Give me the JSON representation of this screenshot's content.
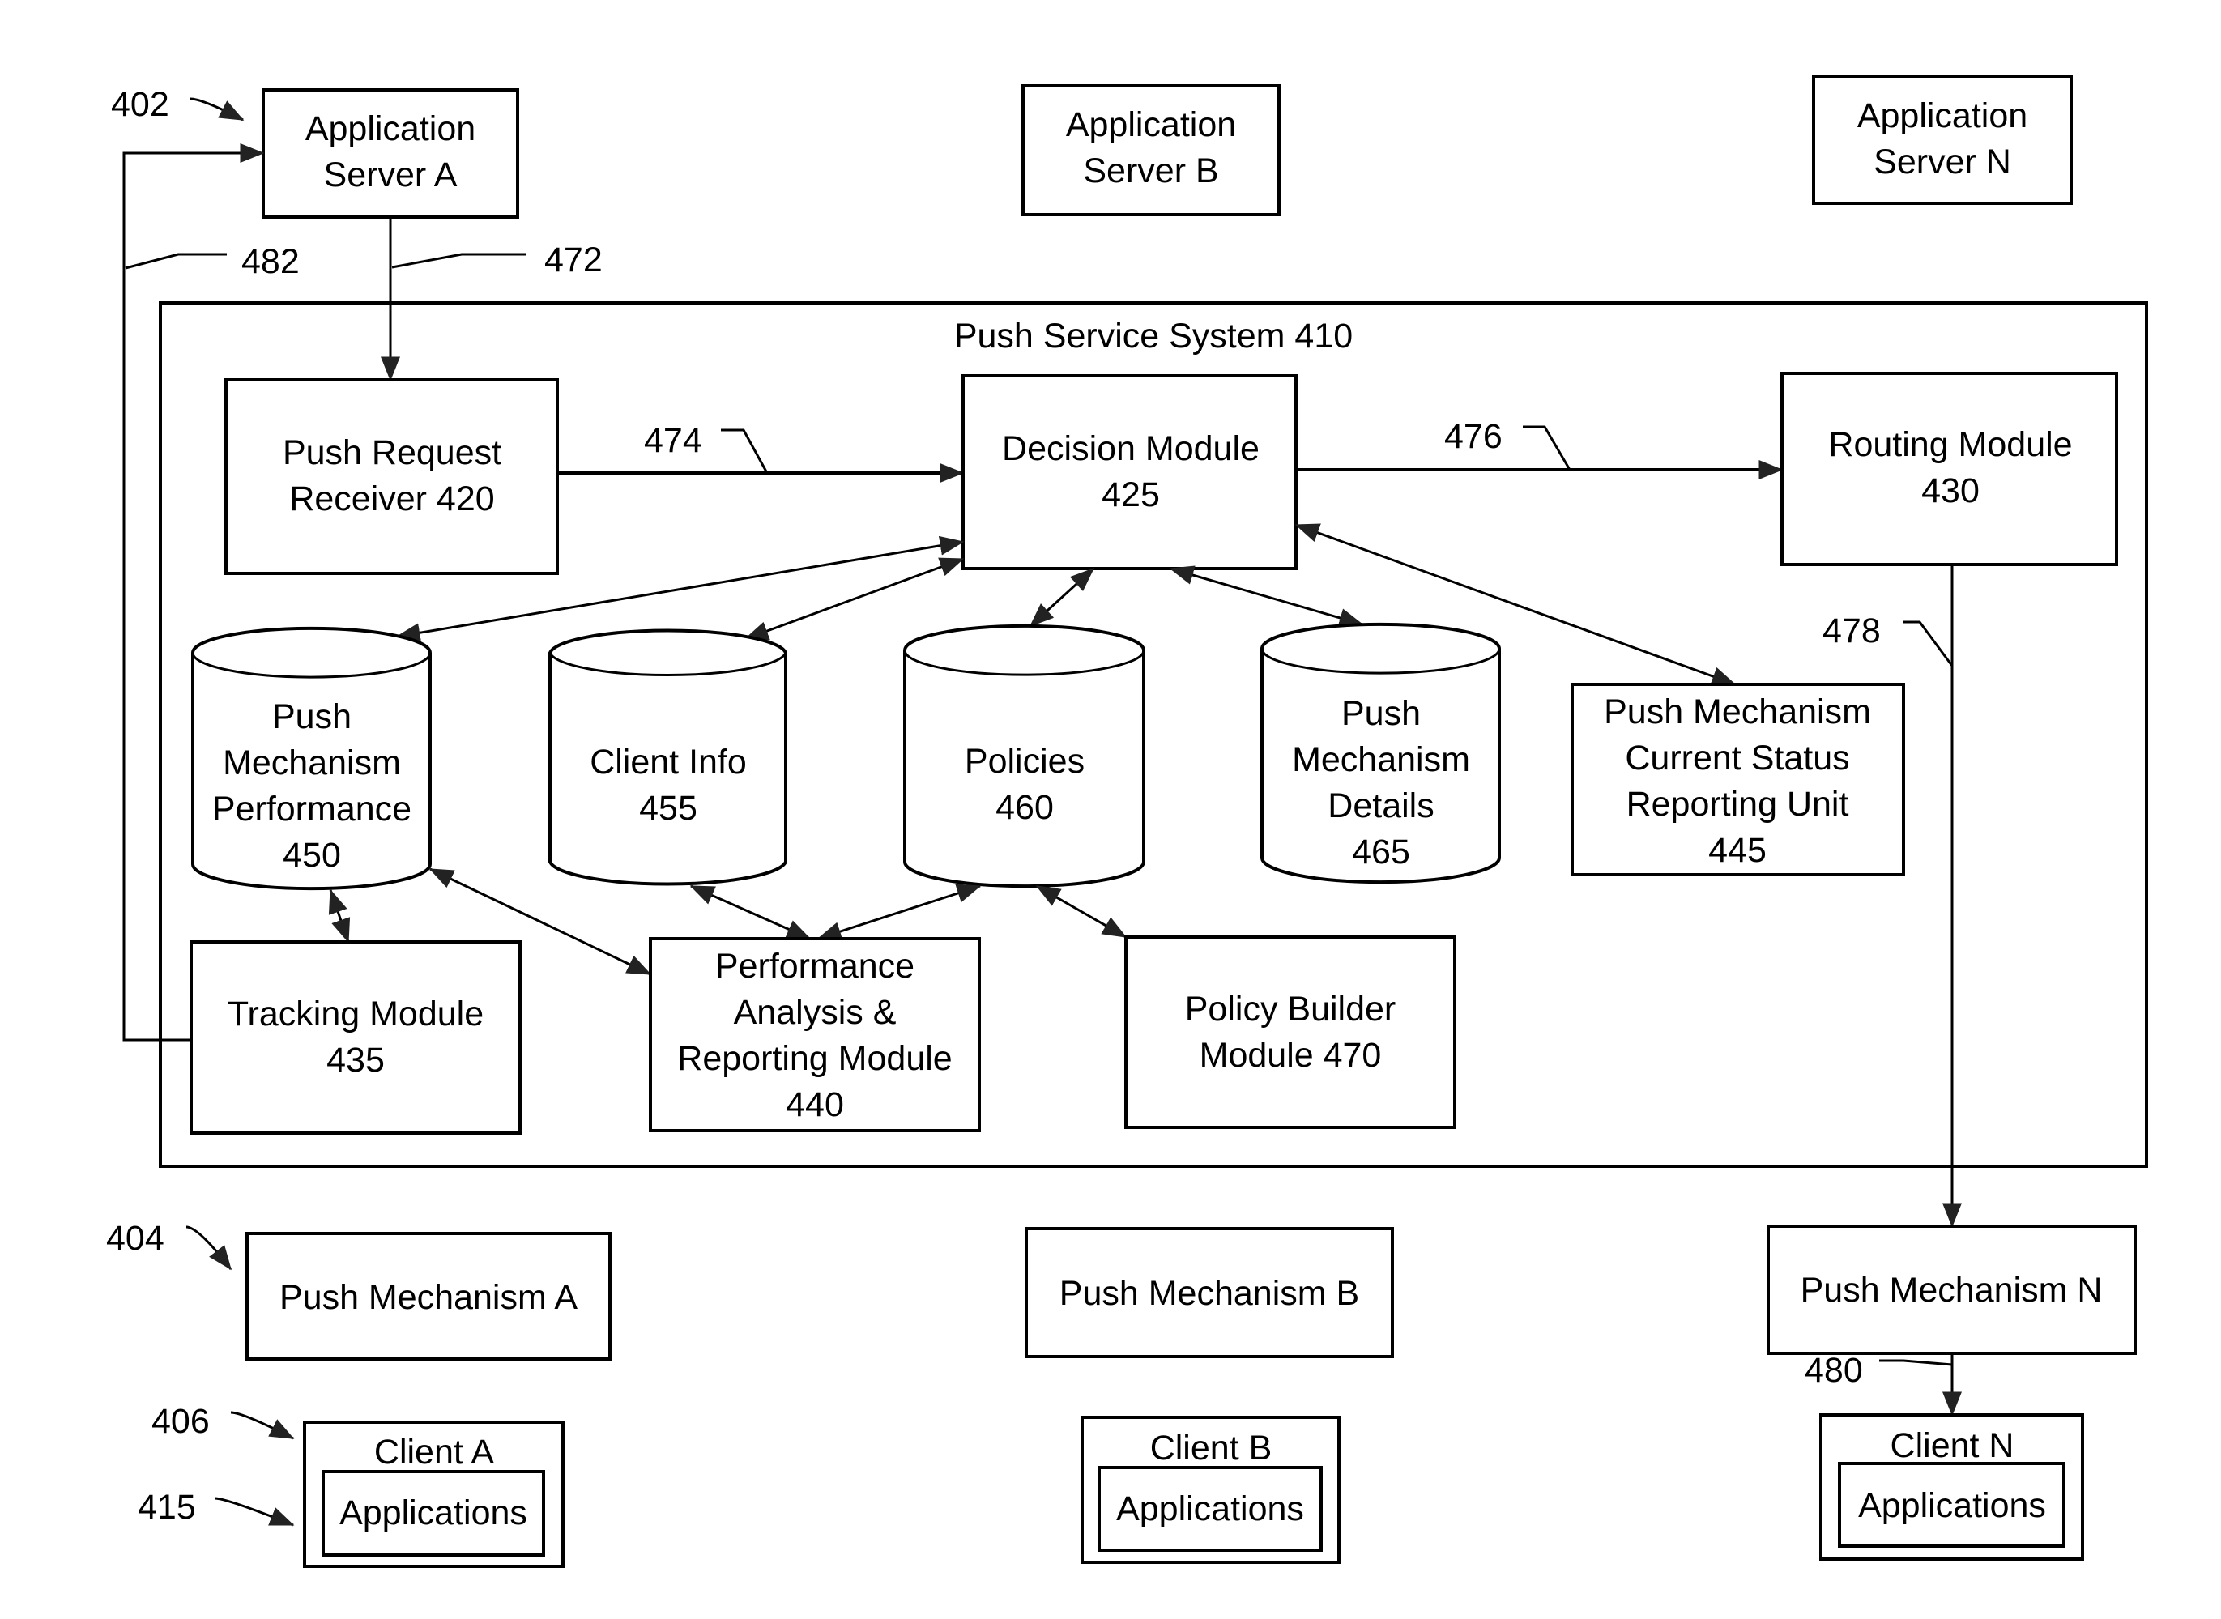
{
  "figure": {
    "application_servers": [
      {
        "id": "app-server-a",
        "lines": [
          "Application",
          "Server A"
        ],
        "ref": "402"
      },
      {
        "id": "app-server-b",
        "lines": [
          "Application",
          "Server B"
        ]
      },
      {
        "id": "app-server-n",
        "lines": [
          "Application",
          "Server N"
        ]
      }
    ],
    "push_service_system": {
      "title": "Push Service System 410"
    },
    "modules": {
      "push_request_receiver": [
        "Push Request",
        "Receiver 420"
      ],
      "decision_module": [
        "Decision Module",
        "425"
      ],
      "routing_module": [
        "Routing Module",
        "430"
      ],
      "status_reporting_unit": [
        "Push Mechanism",
        "Current Status",
        "Reporting Unit",
        "445"
      ],
      "tracking_module": [
        "Tracking Module",
        "435"
      ],
      "performance_analysis": [
        "Performance",
        "Analysis &",
        "Reporting Module",
        "440"
      ],
      "policy_builder": [
        "Policy Builder",
        "Module 470"
      ]
    },
    "databases": {
      "push_mechanism_performance": [
        "Push",
        "Mechanism",
        "Performance",
        "450"
      ],
      "client_info": [
        "Client Info",
        "455"
      ],
      "policies": [
        "Policies",
        "460"
      ],
      "push_mechanism_details": [
        "Push",
        "Mechanism",
        "Details",
        "465"
      ]
    },
    "push_mechanisms": [
      {
        "label": "Push Mechanism A",
        "ref": "404"
      },
      {
        "label": "Push Mechanism B"
      },
      {
        "label": "Push Mechanism N"
      }
    ],
    "clients": [
      {
        "label": "Client A",
        "inner": "Applications",
        "ref": "406",
        "inner_ref": "415"
      },
      {
        "label": "Client B",
        "inner": "Applications"
      },
      {
        "label": "Client N",
        "inner": "Applications"
      }
    ],
    "connection_refs": {
      "r472": "472",
      "r474": "474",
      "r476": "476",
      "r478": "478",
      "r480": "480",
      "r482": "482"
    }
  }
}
